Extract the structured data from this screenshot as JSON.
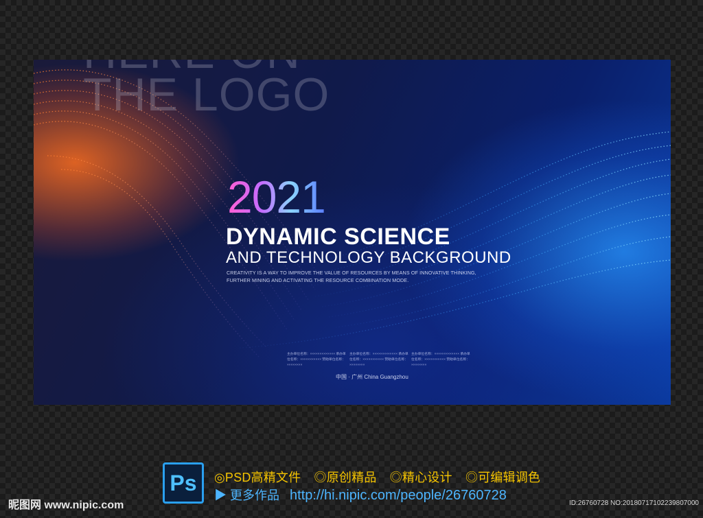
{
  "poster": {
    "logo_line1": "HERE ON",
    "logo_line2": "THE LOGO",
    "year": "2021",
    "headline": "DYNAMIC SCIENCE",
    "subline": "AND TECHNOLOGY BACKGROUND",
    "desc_line1": "CREATIVITY IS A WAY TO IMPROVE THE VALUE OF RESOURCES BY MEANS OF INNOVATIVE THINKING,",
    "desc_line2": "FURTHER MINING AND ACTIVATING THE RESOURCE COMBINATION MODE.",
    "info_blocks": [
      "主办单位名称：××××××××××××× 承办单位名称：××××××××××× 赞助单位名称：××××××××",
      "主办单位名称：××××××××××××× 承办单位名称：××××××××××× 赞助单位名称：××××××××",
      "主办单位名称：××××××××××××× 承办单位名称：××××××××××× 赞助单位名称：××××××××"
    ],
    "location": "中国 · 广州   China Guangzhou"
  },
  "footer": {
    "ps_icon": "photoshop-icon",
    "ps_label": "Ps",
    "features": [
      "◎PSD高精文件",
      "◎原创精品",
      "◎精心设计",
      "◎可编辑调色"
    ],
    "more_label": "▶ 更多作品",
    "url": "http://hi.nipic.com/people/26760728",
    "site": "昵图网 www.nipic.com",
    "id_text": "ID:26760728 NO:20180717102239807000"
  },
  "colors": {
    "feature_text": "#f5c400",
    "link_text": "#4db5ff",
    "ps_icon_border": "#2aa0f0"
  }
}
